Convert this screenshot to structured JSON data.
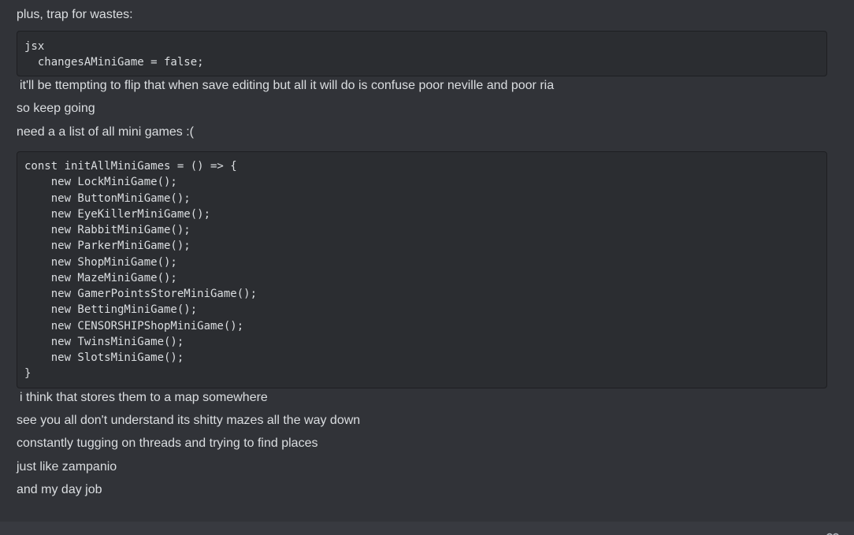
{
  "messages": [
    {
      "text": "plus, trap for wastes:"
    },
    {
      "text": "it'll be ttempting to flip that when save editing but all it will do is confuse poor neville and poor ria"
    },
    {
      "text": "so keep going"
    },
    {
      "text": "need a a list of all mini games :("
    },
    {
      "text": "i think that stores them to a map somewhere"
    },
    {
      "text": "see you all don't understand its shitty mazes all the way down"
    },
    {
      "text": "constantly tugging on threads and trying to find places"
    },
    {
      "text": "just like zampanio"
    },
    {
      "text": "and my day job"
    }
  ],
  "code_blocks": [
    {
      "lines": [
        "jsx",
        "  changesAMiniGame = false;"
      ]
    },
    {
      "lines": [
        "const initAllMiniGames = () => {",
        "    new LockMiniGame();",
        "    new ButtonMiniGame();",
        "    new EyeKillerMiniGame();",
        "    new RabbitMiniGame();",
        "    new ParkerMiniGame();",
        "    new ShopMiniGame();",
        "    new MazeMiniGame();",
        "    new GamerPointsStoreMiniGame();",
        "    new BettingMiniGame();",
        "    new CENSORSHIPShopMiniGame();",
        "    new TwinsMiniGame();",
        "    new SlotsMiniGame();",
        "}"
      ]
    }
  ],
  "icons": {
    "corner": "emoji-icon"
  },
  "colors": {
    "background": "#313338",
    "code_background": "#2b2d31",
    "text": "#dbdee1",
    "input_bar": "#383a40"
  }
}
